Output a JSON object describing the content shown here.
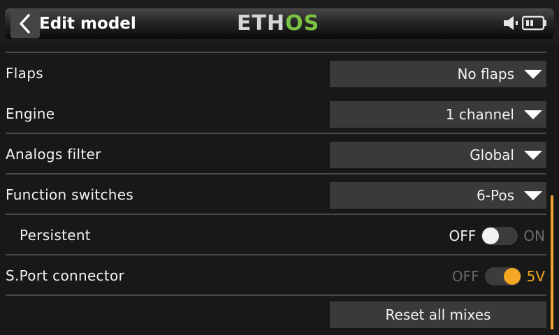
{
  "header": {
    "title": "Edit model",
    "logo_part1": "ETH",
    "logo_part2": "OS"
  },
  "rows": {
    "flaps": {
      "label": "Flaps",
      "value": "No flaps"
    },
    "engine": {
      "label": "Engine",
      "value": "1 channel"
    },
    "analogs_filter": {
      "label": "Analogs filter",
      "value": "Global"
    },
    "function_switches": {
      "label": "Function switches",
      "value": "6-Pos"
    },
    "persistent": {
      "label": "Persistent",
      "off": "OFF",
      "on": "ON",
      "state": "off"
    },
    "sport_connector": {
      "label": "S.Port connector",
      "off": "OFF",
      "on": "5V",
      "state": "on"
    },
    "reset": {
      "label": "Reset all mixes"
    }
  },
  "colors": {
    "accent": "#f5a623",
    "logo_green": "#7cc242",
    "active_text": "#f0f0f0",
    "inactive_text": "#6a6a6a"
  }
}
